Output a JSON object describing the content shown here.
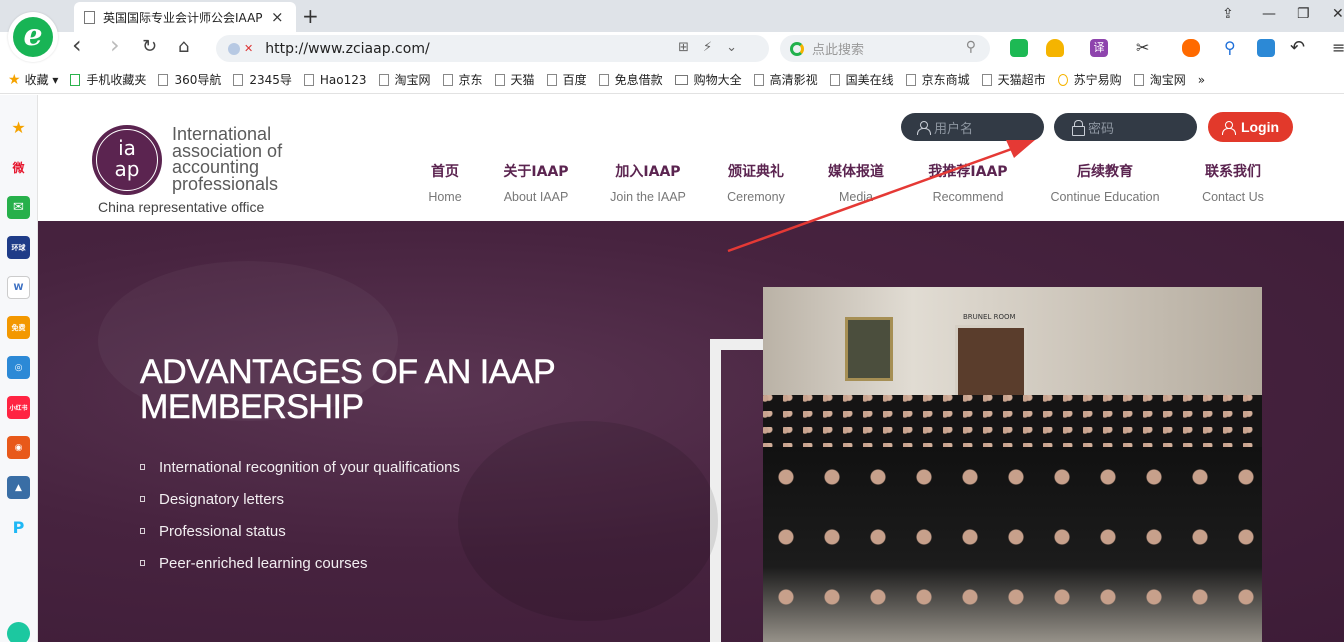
{
  "browser": {
    "tab_title": "英国国际专业会计师公会IAAP",
    "tab_close": "×",
    "new_tab": "+",
    "url": "http://www.zciaap.com/",
    "search_placeholder": "点此搜索",
    "window_controls": [
      "⇪",
      "—",
      "❐",
      "✕"
    ],
    "nav_back": "‹",
    "nav_forward": "›",
    "nav_refresh": "↻",
    "nav_home": "⌂"
  },
  "bookmarks": [
    {
      "label": "收藏",
      "icon": "star-icon"
    },
    {
      "label": "手机收藏夹",
      "icon": "phone-icon"
    },
    {
      "label": "360导航",
      "icon": "doc-icon"
    },
    {
      "label": "2345导",
      "icon": "doc-icon"
    },
    {
      "label": "Hao123",
      "icon": "doc-icon"
    },
    {
      "label": "淘宝网",
      "icon": "doc-icon"
    },
    {
      "label": "京东",
      "icon": "doc-icon"
    },
    {
      "label": "天猫",
      "icon": "doc-icon"
    },
    {
      "label": "百度",
      "icon": "doc-icon"
    },
    {
      "label": "免息借款",
      "icon": "doc-icon"
    },
    {
      "label": "购物大全",
      "icon": "folder-icon"
    },
    {
      "label": "高清影视",
      "icon": "doc-icon"
    },
    {
      "label": "国美在线",
      "icon": "doc-icon"
    },
    {
      "label": "京东商城",
      "icon": "doc-icon"
    },
    {
      "label": "天猫超市",
      "icon": "doc-icon"
    },
    {
      "label": "苏宁易购",
      "icon": "doc-icon"
    },
    {
      "label": "淘宝网",
      "icon": "doc-icon"
    },
    {
      "label": "»",
      "icon": "more-icon"
    }
  ],
  "sidebar_icons": [
    {
      "name": "favorites-icon",
      "glyph": "★",
      "color": "#f5a300"
    },
    {
      "name": "weibo-icon",
      "glyph": "微",
      "color": "#e6162d"
    },
    {
      "name": "mail-icon",
      "glyph": "✉",
      "color": "#27b04b"
    },
    {
      "name": "news-icon",
      "glyph": "环球",
      "color": "#1f3c88"
    },
    {
      "name": "word-icon",
      "glyph": "W",
      "color": "#3b6fc2"
    },
    {
      "name": "novel-icon",
      "glyph": "免费",
      "color": "#f39800"
    },
    {
      "name": "game-icon",
      "glyph": "◎",
      "color": "#2c89d6"
    },
    {
      "name": "xiaohongshu-icon",
      "glyph": "小红书",
      "color": "#ff2442"
    },
    {
      "name": "game2-icon",
      "glyph": "◉",
      "color": "#e8591a"
    },
    {
      "name": "game3-icon",
      "glyph": "▲",
      "color": "#3a6ea5"
    },
    {
      "name": "pdd-icon",
      "glyph": "P",
      "color": "#1fb8f5"
    }
  ],
  "site": {
    "brand": {
      "mark_top": "ia",
      "mark_bottom": "ap",
      "line1": "International",
      "line2": "association of",
      "line3": "accounting",
      "line4": "professionals",
      "subtitle": "China representative office"
    },
    "login": {
      "username_placeholder": "用户名",
      "password_placeholder": "密码",
      "button_label": "Login"
    },
    "nav": [
      {
        "cn": "首页",
        "en": "Home"
      },
      {
        "cn": "关于IAAP",
        "en": "About IAAP"
      },
      {
        "cn": "加入IAAP",
        "en": "Join the IAAP"
      },
      {
        "cn": "颁证典礼",
        "en": "Ceremony"
      },
      {
        "cn": "媒体报道",
        "en": "Media"
      },
      {
        "cn": "我推荐IAAP",
        "en": "Recommend"
      },
      {
        "cn": "后续教育",
        "en": "Continue Education"
      },
      {
        "cn": "联系我们",
        "en": "Contact Us"
      }
    ],
    "hero": {
      "title_line1": "ADVANTAGES OF AN IAAP",
      "title_line2": "MEMBERSHIP",
      "benefits": [
        "International recognition of your qualifications",
        "Designatory letters",
        "Professional status",
        "Peer-enriched learning courses"
      ],
      "photo_sign": "BRUNEL ROOM"
    }
  },
  "colors": {
    "brand_purple": "#5b2450",
    "hero_bg": "#47233f",
    "login_red": "#e2392b",
    "login_field": "#323a45",
    "annotation_arrow": "#e53935"
  }
}
